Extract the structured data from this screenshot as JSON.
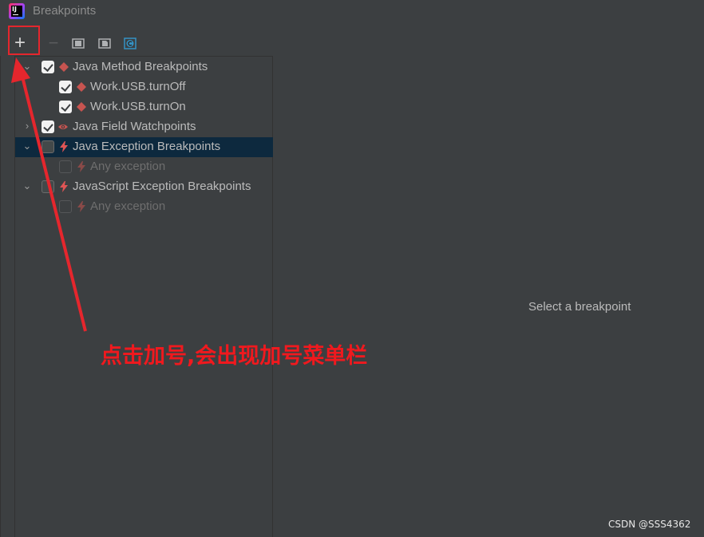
{
  "window": {
    "title": "Breakpoints"
  },
  "toolbar": {
    "add_label": "+",
    "remove_label": "−",
    "icons": [
      "add-icon",
      "remove-icon",
      "group-by-package-icon",
      "group-by-file-icon",
      "group-by-class-icon"
    ]
  },
  "tree": {
    "items": [
      {
        "label": "Java Method Breakpoints",
        "checked": true,
        "expanded": true,
        "icon": "method-breakpoint-icon"
      },
      {
        "label": "Work.USB.turnOff",
        "checked": true,
        "icon": "method-breakpoint-icon"
      },
      {
        "label": "Work.USB.turnOn",
        "checked": true,
        "icon": "method-breakpoint-icon"
      },
      {
        "label": "Java Field Watchpoints",
        "checked": true,
        "expanded": false,
        "icon": "watchpoint-eye-icon"
      },
      {
        "label": "Java Exception Breakpoints",
        "checked": false,
        "expanded": true,
        "selected": true,
        "icon": "exception-breakpoint-icon"
      },
      {
        "label": "Any exception",
        "checked": false,
        "disabled": true,
        "icon": "exception-breakpoint-icon"
      },
      {
        "label": "JavaScript Exception Breakpoints",
        "checked": false,
        "expanded": true,
        "icon": "exception-breakpoint-icon"
      },
      {
        "label": "Any exception",
        "checked": false,
        "disabled": true,
        "icon": "exception-breakpoint-icon"
      }
    ]
  },
  "detail": {
    "placeholder": "Select a breakpoint"
  },
  "annotation": {
    "text": "点击加号,会出现加号菜单栏",
    "color": "#e5262d"
  },
  "watermark": "CSDN @SSS4362",
  "colors": {
    "background": "#3c3f41",
    "selection": "#0d293e",
    "breakpoint_red": "#c75450"
  }
}
